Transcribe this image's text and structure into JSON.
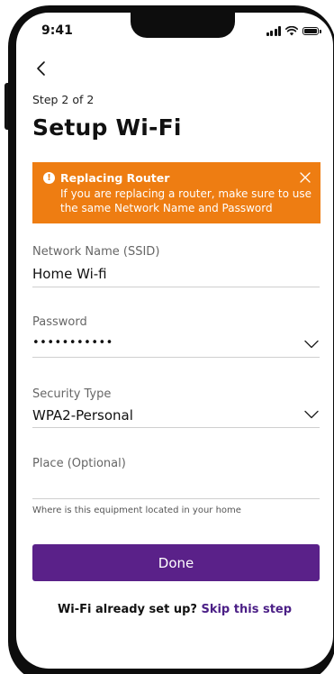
{
  "status_bar": {
    "time": "9:41",
    "icons": [
      "signal-icon",
      "wifi-icon",
      "battery-icon"
    ]
  },
  "header": {
    "back_icon": "chevron-left-icon",
    "step": "Step 2 of 2",
    "title": "Setup Wi-Fi"
  },
  "alert": {
    "icon": "exclamation-icon",
    "title": "Replacing Router",
    "message": "If you are replacing a router, make sure to use the same Network Name and Password",
    "close_icon": "close-icon",
    "color": "#ee7d12"
  },
  "form": {
    "network_name": {
      "label": "Network Name (SSID)",
      "value": "Home Wi-fi"
    },
    "password": {
      "label": "Password",
      "value": "•••••••••••"
    },
    "security_type": {
      "label": "Security Type",
      "value": "WPA2-Personal"
    },
    "place": {
      "label": "Place (Optional)",
      "value": "",
      "helper": "Where is this equipment located in your home"
    }
  },
  "actions": {
    "done_label": "Done",
    "done_color": "#5a2189",
    "footer_question": "Wi-Fi already set up?",
    "skip_label": "Skip this step",
    "link_color": "#4b1f86"
  }
}
